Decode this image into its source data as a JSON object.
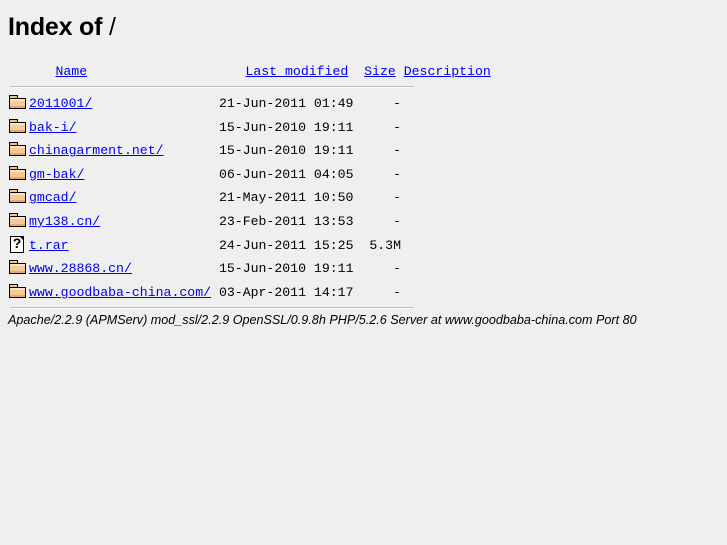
{
  "title": {
    "prefix": "Index of ",
    "path": "/"
  },
  "columns": {
    "name": "Name",
    "last_modified": "Last modified",
    "size": "Size",
    "description": "Description"
  },
  "entries": [
    {
      "icon": "folder-icon",
      "name": "2011001/",
      "last_modified": "21-Jun-2011 01:49",
      "size": "-",
      "description": ""
    },
    {
      "icon": "folder-icon",
      "name": "bak-i/",
      "last_modified": "15-Jun-2010 19:11",
      "size": "-",
      "description": ""
    },
    {
      "icon": "folder-icon",
      "name": "chinagarment.net/",
      "last_modified": "15-Jun-2010 19:11",
      "size": "-",
      "description": ""
    },
    {
      "icon": "folder-icon",
      "name": "gm-bak/",
      "last_modified": "06-Jun-2011 04:05",
      "size": "-",
      "description": ""
    },
    {
      "icon": "folder-icon",
      "name": "gmcad/",
      "last_modified": "21-May-2011 10:50",
      "size": "-",
      "description": ""
    },
    {
      "icon": "folder-icon",
      "name": "my138.cn/",
      "last_modified": "23-Feb-2011 13:53",
      "size": "-",
      "description": ""
    },
    {
      "icon": "unknown-file-icon",
      "name": "t.rar",
      "last_modified": "24-Jun-2011 15:25",
      "size": "5.3M",
      "description": ""
    },
    {
      "icon": "folder-icon",
      "name": "www.28868.cn/",
      "last_modified": "15-Jun-2010 19:11",
      "size": "-",
      "description": ""
    },
    {
      "icon": "folder-icon",
      "name": "www.goodbaba-china.com/",
      "last_modified": "03-Apr-2011 14:17",
      "size": "-",
      "description": ""
    }
  ],
  "footer": {
    "signature": "Apache/2.2.9 (APMServ) mod_ssl/2.2.9 OpenSSL/0.9.8h PHP/5.2.6 Server at www.goodbaba-china.com Port 80"
  },
  "colors": {
    "background": "#efefef",
    "link": "#0000ee",
    "text": "#000000",
    "rule": "#bdbdbd",
    "folder": "#f6c99a"
  }
}
